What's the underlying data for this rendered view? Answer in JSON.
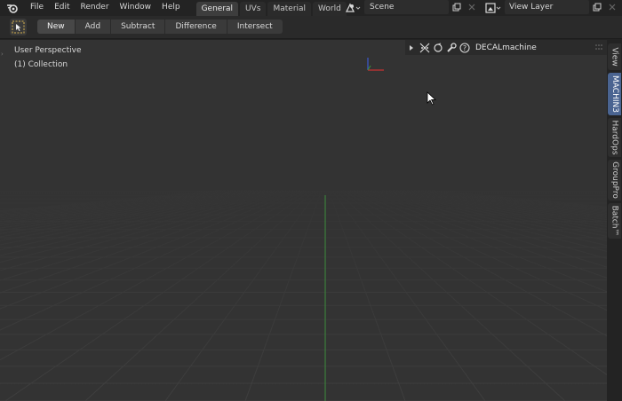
{
  "menu": {
    "items": [
      "File",
      "Edit",
      "Render",
      "Window",
      "Help"
    ]
  },
  "workspaces": {
    "tabs": [
      "General",
      "UVs",
      "Material",
      "World"
    ],
    "active": "General"
  },
  "scene": {
    "name": "Scene"
  },
  "view_layer": {
    "name": "View Layer"
  },
  "toolbar": {
    "modes": [
      "New",
      "Add",
      "Subtract",
      "Difference",
      "Intersect"
    ]
  },
  "viewport": {
    "perspective_label": "User Perspective",
    "collection_label": "(1) Collection"
  },
  "panel": {
    "title": "DECALmachine"
  },
  "sidebar": {
    "tabs": [
      "View",
      "MACHIN3",
      "HardOps",
      "GroupPro",
      "Batch™"
    ],
    "active": "MACHIN3"
  },
  "colors": {
    "accent": "#4a6491",
    "axis_green": "#3c8c3c",
    "axis_red": "#c83232",
    "axis_blue": "#3c5ad2"
  }
}
